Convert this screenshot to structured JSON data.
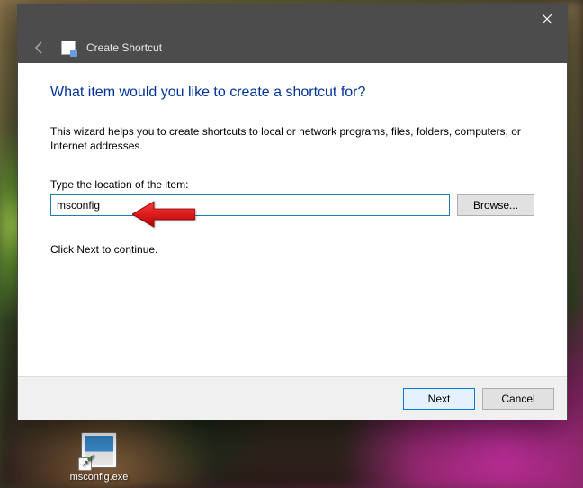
{
  "window": {
    "title": "Create Shortcut"
  },
  "wizard": {
    "heading": "What item would you like to create a shortcut for?",
    "description": "This wizard helps you to create shortcuts to local or network programs, files, folders, computers, or Internet addresses.",
    "location_label": "Type the location of the item:",
    "location_value": "msconfig",
    "browse_label": "Browse...",
    "hint": "Click Next to continue."
  },
  "footer": {
    "next_label": "Next",
    "cancel_label": "Cancel"
  },
  "desktop": {
    "shortcut_name": "msconfig.exe"
  }
}
